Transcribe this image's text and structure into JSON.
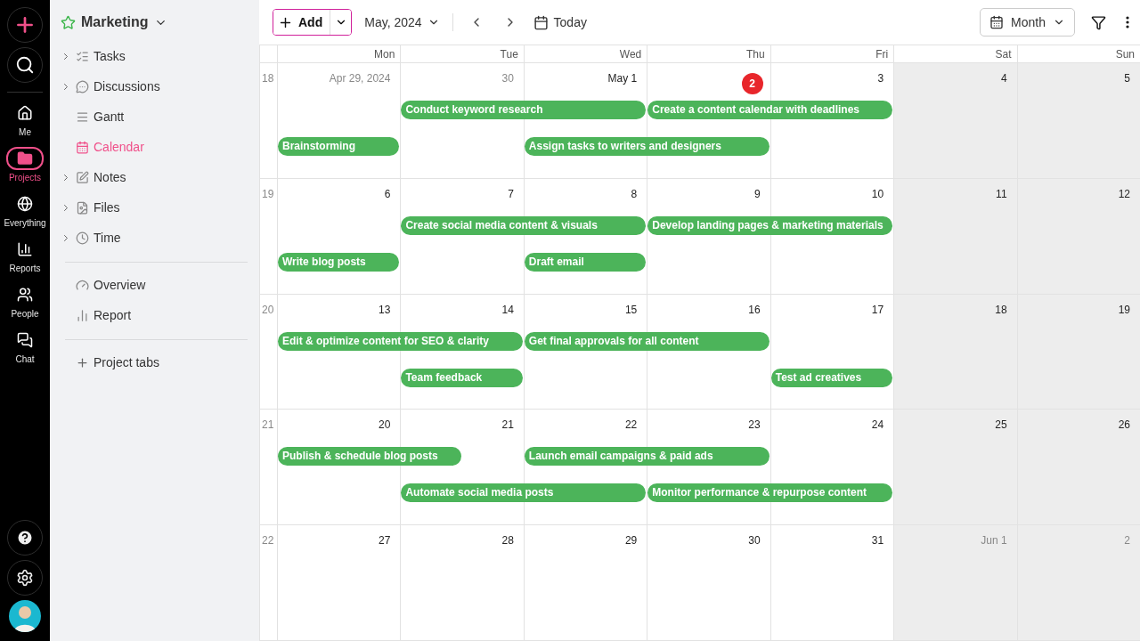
{
  "rail": {
    "items": [
      {
        "label": "Me",
        "selected": false
      },
      {
        "label": "Projects",
        "selected": true
      },
      {
        "label": "Everything",
        "selected": false
      },
      {
        "label": "Reports",
        "selected": false
      },
      {
        "label": "People",
        "selected": false
      },
      {
        "label": "Chat",
        "selected": false
      }
    ]
  },
  "project_nav": {
    "title": "Marketing",
    "groups": [
      [
        {
          "label": "Tasks",
          "expandable": true,
          "selected": false
        },
        {
          "label": "Discussions",
          "expandable": true,
          "selected": false
        },
        {
          "label": "Gantt",
          "expandable": false,
          "selected": false
        },
        {
          "label": "Calendar",
          "expandable": false,
          "selected": true
        },
        {
          "label": "Notes",
          "expandable": true,
          "selected": false
        },
        {
          "label": "Files",
          "expandable": true,
          "selected": false
        },
        {
          "label": "Time",
          "expandable": true,
          "selected": false
        }
      ],
      [
        {
          "label": "Overview",
          "expandable": false,
          "selected": false
        },
        {
          "label": "Report",
          "expandable": false,
          "selected": false
        }
      ]
    ],
    "add_tab": "Project tabs"
  },
  "toolbar": {
    "add": "Add",
    "period": "May, 2024",
    "today": "Today",
    "view": "Month"
  },
  "calendar": {
    "weekdays": [
      "Mon",
      "Tue",
      "Wed",
      "Thu",
      "Fri",
      "Sat",
      "Sun"
    ],
    "weeks": [
      {
        "number": "18",
        "days": [
          {
            "label": "Apr 29, 2024",
            "kind": "outside",
            "weekend": false
          },
          {
            "label": "30",
            "kind": "outside",
            "weekend": false
          },
          {
            "label": "May 1",
            "kind": "normal",
            "weekend": false
          },
          {
            "label": "2",
            "kind": "today",
            "weekend": false
          },
          {
            "label": "3",
            "kind": "normal",
            "weekend": false
          },
          {
            "label": "4",
            "kind": "normal",
            "weekend": true
          },
          {
            "label": "5",
            "kind": "normal",
            "weekend": true
          }
        ],
        "lanes": [
          [
            {
              "kind": "empty"
            },
            {
              "kind": "event",
              "title": "Conduct keyword research"
            },
            {
              "kind": "more"
            },
            {
              "kind": "event",
              "title": "Create a content calendar with deadlines"
            },
            {
              "kind": "more"
            },
            {
              "kind": "empty"
            },
            {
              "kind": "empty"
            }
          ],
          [
            {
              "kind": "event",
              "title": "Brainstorming"
            },
            {
              "kind": "empty"
            },
            {
              "kind": "event",
              "title": "Assign tasks to writers and designers"
            },
            {
              "kind": "more"
            },
            {
              "kind": "empty"
            },
            {
              "kind": "empty"
            },
            {
              "kind": "empty"
            }
          ]
        ]
      },
      {
        "number": "19",
        "days": [
          {
            "label": "6",
            "kind": "normal",
            "weekend": false
          },
          {
            "label": "7",
            "kind": "normal",
            "weekend": false
          },
          {
            "label": "8",
            "kind": "normal",
            "weekend": false
          },
          {
            "label": "9",
            "kind": "normal",
            "weekend": false
          },
          {
            "label": "10",
            "kind": "normal",
            "weekend": false
          },
          {
            "label": "11",
            "kind": "normal",
            "weekend": true
          },
          {
            "label": "12",
            "kind": "normal",
            "weekend": true
          }
        ],
        "lanes": [
          [
            {
              "kind": "empty"
            },
            {
              "kind": "event",
              "title": "Create social media content & visuals"
            },
            {
              "kind": "more"
            },
            {
              "kind": "event",
              "title": "Develop landing pages & marketing materials"
            },
            {
              "kind": "more"
            },
            {
              "kind": "empty"
            },
            {
              "kind": "empty"
            }
          ],
          [
            {
              "kind": "event",
              "title": "Write blog posts"
            },
            {
              "kind": "empty"
            },
            {
              "kind": "event",
              "title": "Draft email"
            },
            {
              "kind": "empty"
            },
            {
              "kind": "empty"
            },
            {
              "kind": "empty"
            },
            {
              "kind": "empty"
            }
          ]
        ]
      },
      {
        "number": "20",
        "days": [
          {
            "label": "13",
            "kind": "normal",
            "weekend": false
          },
          {
            "label": "14",
            "kind": "normal",
            "weekend": false
          },
          {
            "label": "15",
            "kind": "normal",
            "weekend": false
          },
          {
            "label": "16",
            "kind": "normal",
            "weekend": false
          },
          {
            "label": "17",
            "kind": "normal",
            "weekend": false
          },
          {
            "label": "18",
            "kind": "normal",
            "weekend": true
          },
          {
            "label": "19",
            "kind": "normal",
            "weekend": true
          }
        ],
        "lanes": [
          [
            {
              "kind": "event",
              "title": "Edit & optimize content for SEO & clarity"
            },
            {
              "kind": "more"
            },
            {
              "kind": "event",
              "title": "Get final approvals for all content"
            },
            {
              "kind": "more"
            },
            {
              "kind": "empty"
            },
            {
              "kind": "empty"
            },
            {
              "kind": "empty"
            }
          ],
          [
            {
              "kind": "empty"
            },
            {
              "kind": "event",
              "title": "Team feedback"
            },
            {
              "kind": "empty"
            },
            {
              "kind": "empty"
            },
            {
              "kind": "event",
              "title": "Test ad creatives"
            },
            {
              "kind": "empty"
            },
            {
              "kind": "empty"
            }
          ]
        ]
      },
      {
        "number": "21",
        "days": [
          {
            "label": "20",
            "kind": "normal",
            "weekend": false
          },
          {
            "label": "21",
            "kind": "normal",
            "weekend": false
          },
          {
            "label": "22",
            "kind": "normal",
            "weekend": false
          },
          {
            "label": "23",
            "kind": "normal",
            "weekend": false
          },
          {
            "label": "24",
            "kind": "normal",
            "weekend": false
          },
          {
            "label": "25",
            "kind": "normal",
            "weekend": true
          },
          {
            "label": "26",
            "kind": "normal",
            "weekend": true
          }
        ],
        "lanes": [
          [
            {
              "kind": "event",
              "title": "Publish & schedule blog posts"
            },
            {
              "kind": "half"
            },
            {
              "kind": "event",
              "title": "Launch email campaigns & paid ads"
            },
            {
              "kind": "more"
            },
            {
              "kind": "empty"
            },
            {
              "kind": "empty"
            },
            {
              "kind": "empty"
            }
          ],
          [
            {
              "kind": "empty"
            },
            {
              "kind": "event",
              "title": "Automate social media posts"
            },
            {
              "kind": "more"
            },
            {
              "kind": "event",
              "title": "Monitor performance & repurpose content"
            },
            {
              "kind": "more"
            },
            {
              "kind": "empty"
            },
            {
              "kind": "empty"
            }
          ]
        ]
      },
      {
        "number": "22",
        "days": [
          {
            "label": "27",
            "kind": "normal",
            "weekend": false
          },
          {
            "label": "28",
            "kind": "normal",
            "weekend": false
          },
          {
            "label": "29",
            "kind": "normal",
            "weekend": false
          },
          {
            "label": "30",
            "kind": "normal",
            "weekend": false
          },
          {
            "label": "31",
            "kind": "normal",
            "weekend": false
          },
          {
            "label": "Jun 1",
            "kind": "outside",
            "weekend": true
          },
          {
            "label": "2",
            "kind": "outside",
            "weekend": true
          }
        ]
      }
    ]
  }
}
